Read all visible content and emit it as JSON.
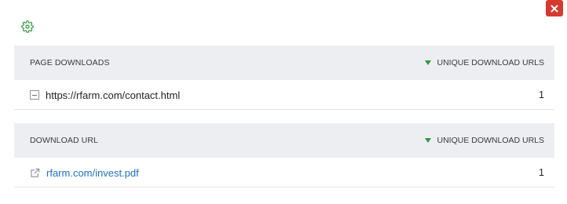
{
  "close_button": {
    "icon": "close-icon",
    "color": "#d43a2f"
  },
  "settings": {
    "icon": "gear-icon",
    "color": "#2e9a3e"
  },
  "page_downloads": {
    "header_left": "PAGE DOWNLOADS",
    "header_right": "UNIQUE DOWNLOAD URLS",
    "rows": [
      {
        "url": "https://rfarm.com/contact.html",
        "count": "1"
      }
    ]
  },
  "download_url": {
    "header_left": "DOWNLOAD URL",
    "header_right": "UNIQUE DOWNLOAD URLS",
    "rows": [
      {
        "url": "rfarm.com/invest.pdf",
        "count": "1"
      }
    ]
  },
  "colors": {
    "header_bg": "#eceef1",
    "link": "#2170c2",
    "sort_indicator": "#2e9a3e"
  }
}
